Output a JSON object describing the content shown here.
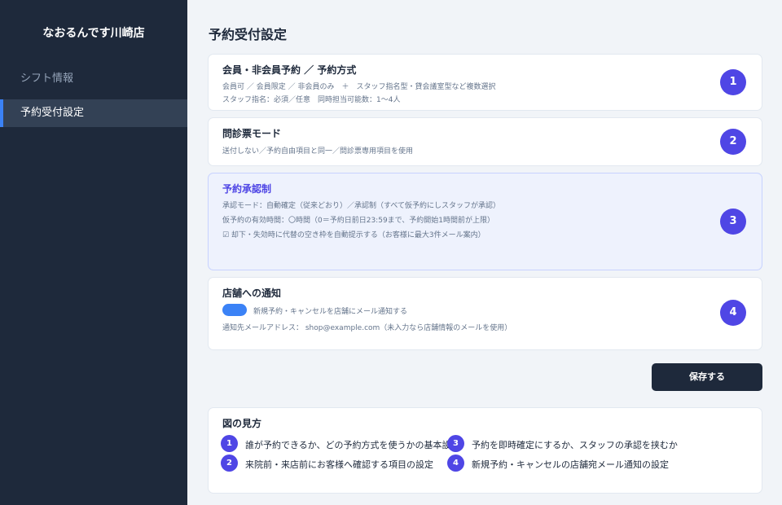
{
  "sidebar": {
    "brand": "なおるんです川崎店",
    "items": [
      {
        "label": "シフト情報",
        "active": false
      },
      {
        "label": "予約受付設定",
        "active": true
      }
    ],
    "accent_color": "#3b82f6"
  },
  "page": {
    "title": "予約受付設定"
  },
  "cards": [
    {
      "number": "1",
      "title": "会員・非会員予約 ／ 予約方式",
      "lines": [
        "会員可 ／ 会員限定 ／ 非会員のみ　＋　スタッフ指名型・貸会議室型など複数選択",
        "スタッフ指名：必須／任意　同時担当可能数：1〜4人"
      ]
    },
    {
      "number": "2",
      "title": "問診票モード",
      "lines": [
        "送付しない／予約自由項目と同一／問診票専用項目を使用"
      ]
    },
    {
      "number": "3",
      "title": "予約承認制",
      "highlighted": true,
      "lines": [
        "承認モード：自動確定（従来どおり）／承認制（すべて仮予約にしスタッフが承認）",
        "仮予約の有効時間：〇時間（0＝予約日前日23:59まで、予約開始1時間前が上限）",
        "☑ 却下・失効時に代替の空き枠を自動提示する（お客様に最大3件メール案内）"
      ]
    },
    {
      "number": "4",
      "title": "店舗への通知",
      "toggle_on": true,
      "toggle_label": "新規予約・キャンセルを店舗にメール通知する",
      "line": "通知先メールアドレス： shop@example.com（未入力なら店舗情報のメールを使用）"
    }
  ],
  "save_label": "保存する",
  "legend": {
    "title": "図の見方",
    "items": [
      {
        "number": "1",
        "text": "誰が予約できるか、どの予約方式を使うかの基本設定"
      },
      {
        "number": "3",
        "text": "予約を即時確定にするか、スタッフの承認を挟むか"
      },
      {
        "number": "2",
        "text": "来院前・来店前にお客様へ確認する項目の設定"
      },
      {
        "number": "4",
        "text": "新規予約・キャンセルの店舗宛メール通知の設定"
      }
    ]
  },
  "colors": {
    "sidebar_bg": "#1e293b",
    "badge": "#4f46e5",
    "page_bg": "#f1f4f8"
  }
}
